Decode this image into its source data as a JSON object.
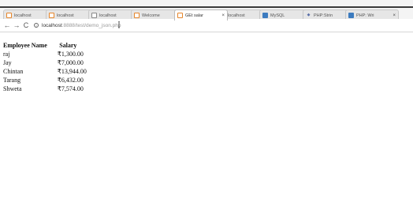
{
  "browser": {
    "tabs": [
      {
        "label": "localhost",
        "icon": "xampp-orange-icon"
      },
      {
        "label": "localhost",
        "icon": "xampp-orange-icon"
      },
      {
        "label": "localhost",
        "icon": "page-icon"
      },
      {
        "label": "Welcome",
        "icon": "xampp-orange-icon"
      },
      {
        "label": "GEt salar",
        "icon": "xampp-orange-icon",
        "active": true
      },
      {
        "label": "localhost",
        "icon": "xampp-orange-icon"
      },
      {
        "label": "MySQL",
        "icon": "mysql-icon"
      },
      {
        "label": "PHP:Strin",
        "icon": "php-icon"
      },
      {
        "label": "PHP: Wri",
        "icon": "php-manual-icon"
      }
    ],
    "close_glyph": "×",
    "nav": {
      "back": "←",
      "forward": "→",
      "reload": "C"
    },
    "url": {
      "host": "localhost",
      "path": ":8888/test/demo_json.php"
    }
  },
  "page": {
    "headers": [
      "Employee Name",
      "Salary"
    ],
    "rows": [
      {
        "name": "raj",
        "salary": "₹1,300.00"
      },
      {
        "name": "Jay",
        "salary": "₹7,000.00"
      },
      {
        "name": "Chintan",
        "salary": "₹13,944.00"
      },
      {
        "name": "Tarang",
        "salary": "₹6,432.00"
      },
      {
        "name": "Shweta",
        "salary": "₹7,574.00"
      }
    ]
  },
  "colors": {
    "xampp_orange": "#e6862b",
    "tab_active_bg": "#ffffff",
    "tab_bg": "#e6e6e6"
  }
}
